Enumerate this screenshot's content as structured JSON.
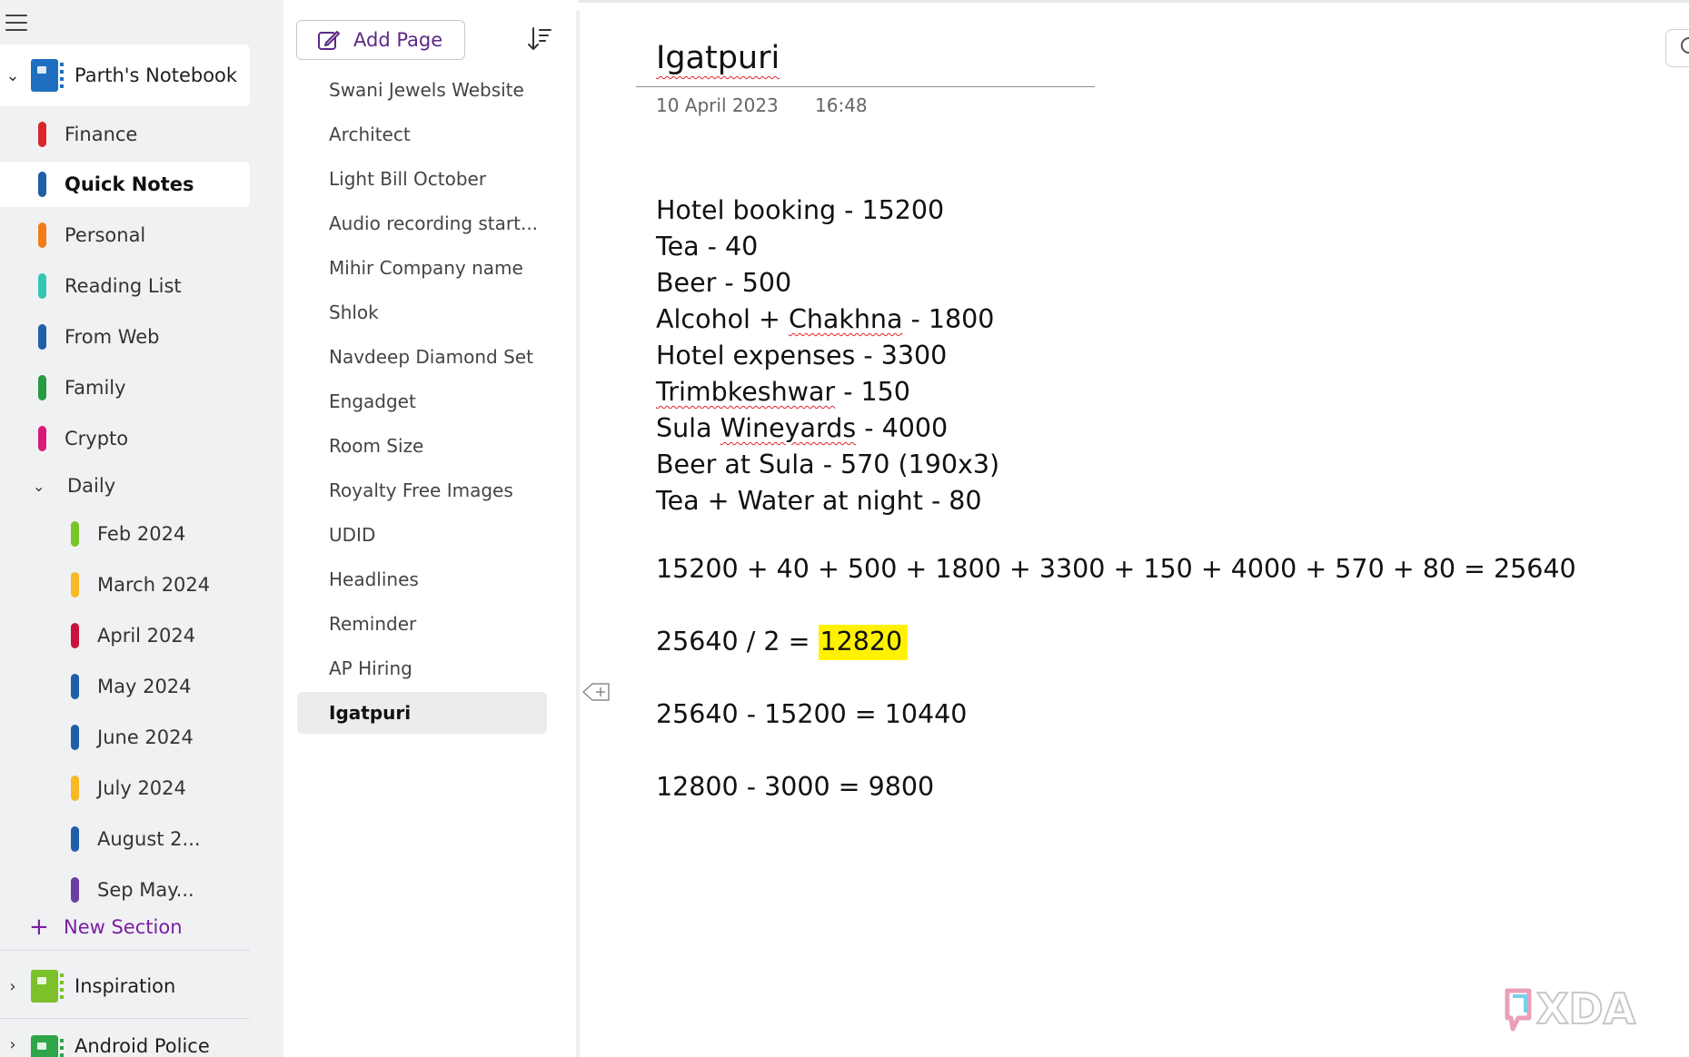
{
  "sidebar": {
    "notebooks": [
      {
        "label": "Parth's Notebook",
        "expanded": true,
        "color": "#1e6fc0"
      },
      {
        "label": "Inspiration",
        "expanded": false,
        "color": "#7cc02a"
      },
      {
        "label": "Android Police",
        "expanded": false,
        "color": "#2fa64a"
      }
    ],
    "sections": [
      {
        "label": "Finance",
        "color": "#d9262c"
      },
      {
        "label": "Quick Notes",
        "color": "#1f5fa8",
        "active": true
      },
      {
        "label": "Personal",
        "color": "#f07d1a"
      },
      {
        "label": "Reading List",
        "color": "#34c6b2"
      },
      {
        "label": "From Web",
        "color": "#1f5fa8"
      },
      {
        "label": "Family",
        "color": "#2a9a42"
      },
      {
        "label": "Crypto",
        "color": "#d81b7a"
      }
    ],
    "group": {
      "label": "Daily",
      "expanded": true
    },
    "sub_sections": [
      {
        "label": "Feb 2024",
        "color": "#79c429"
      },
      {
        "label": "March 2024",
        "color": "#f7b924"
      },
      {
        "label": "April 2024",
        "color": "#c8143c"
      },
      {
        "label": "May 2024",
        "color": "#1f5fa8"
      },
      {
        "label": "June 2024",
        "color": "#1f5fa8"
      },
      {
        "label": "July 2024",
        "color": "#f7b924"
      },
      {
        "label": "August 2...",
        "color": "#1f5fa8"
      },
      {
        "label": "Sep May...",
        "color": "#6b3fa0"
      }
    ],
    "new_section_label": "New Section"
  },
  "pagelist": {
    "add_page_label": "Add Page",
    "pages": [
      "Swani Jewels Website",
      "Architect",
      "Light Bill October",
      "Audio recording start...",
      "Mihir Company name",
      "Shlok",
      "Navdeep Diamond Set",
      "Engadget",
      "Room Size",
      "Royalty Free Images",
      "UDID",
      "Headlines",
      "Reminder",
      "AP Hiring",
      "Igatpuri"
    ],
    "active_page": "Igatpuri"
  },
  "page": {
    "title": "Igatpuri",
    "date": "10 April 2023",
    "time": "16:48",
    "lines": {
      "l1": "Hotel booking - 15200",
      "l2": "Tea - 40",
      "l3": "Beer - 500",
      "l4_a": "Alcohol + ",
      "l4_b": "Chakhna",
      "l4_c": " - 1800",
      "l5": "Hotel expenses - 3300",
      "l6_a": "Trimbkeshwar",
      "l6_b": " - 150",
      "l7_a": "Sula ",
      "l7_b": "Wineyards",
      "l7_c": " - 4000",
      "l8": "Beer at Sula - 570 (190x3)",
      "l9": "Tea + Water at night - 80"
    },
    "sum_line": "15200 + 40 + 500 + 1800 + 3300 + 150 + 4000 + 570 + 80 = 25640",
    "split_prefix": "25640 / 2 = ",
    "split_result": "12820",
    "diff_line": "25640 - 15200 = 10440",
    "final_line": "12800 - 3000 = 9800",
    "highlight_color": "#fff200"
  },
  "watermark": {
    "brand": "XDA"
  }
}
